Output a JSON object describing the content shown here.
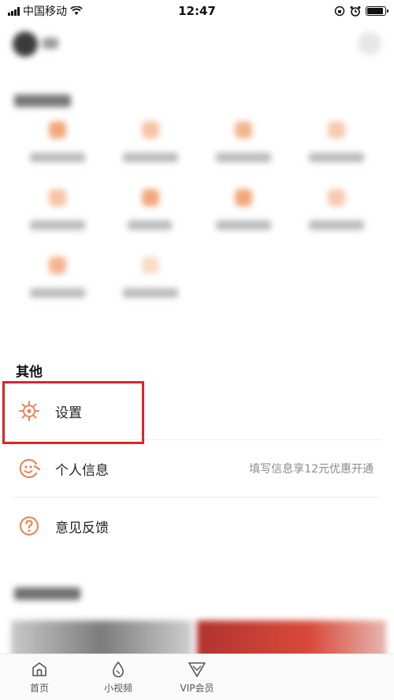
{
  "status_bar": {
    "carrier": "中国移动",
    "time": "12:47"
  },
  "colors": {
    "accent": "#e8875a",
    "highlight_border": "#d9262b"
  },
  "others_section": {
    "title": "其他",
    "items": [
      {
        "label": "设置",
        "icon": "gear-icon",
        "right_text": ""
      },
      {
        "label": "个人信息",
        "icon": "smile-wrench-icon",
        "right_text": "填写信息享12元优惠开通"
      },
      {
        "label": "意见反馈",
        "icon": "question-icon",
        "right_text": ""
      }
    ]
  },
  "tab_bar": {
    "tabs": [
      {
        "label": "首页",
        "icon": "home-icon"
      },
      {
        "label": "小视频",
        "icon": "drop-icon"
      },
      {
        "label": "VIP会员",
        "icon": "vip-icon"
      }
    ]
  }
}
